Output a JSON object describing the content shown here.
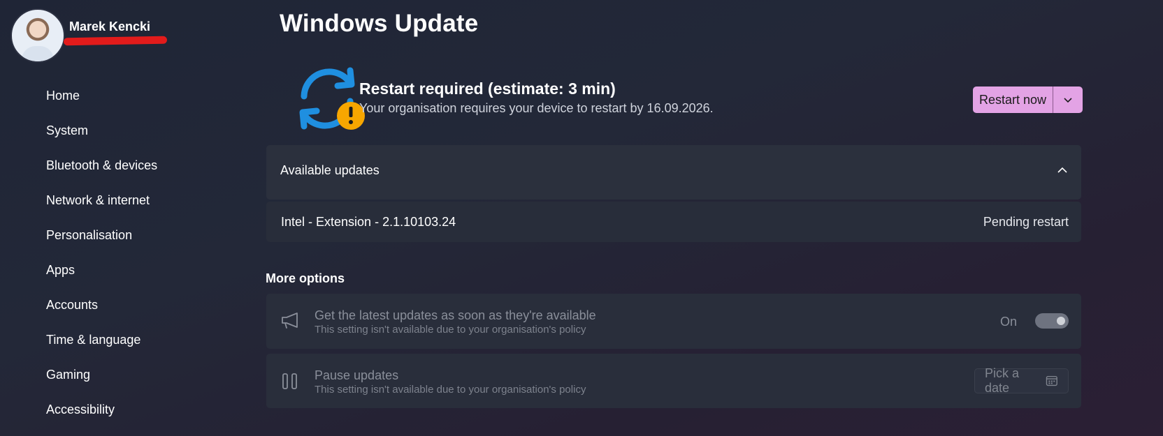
{
  "user": {
    "name": "Marek Kencki"
  },
  "nav": {
    "items": [
      "Home",
      "System",
      "Bluetooth & devices",
      "Network & internet",
      "Personalisation",
      "Apps",
      "Accounts",
      "Time & language",
      "Gaming",
      "Accessibility"
    ]
  },
  "page": {
    "title": "Windows Update"
  },
  "status": {
    "title": "Restart required (estimate: 3 min)",
    "subtitle": "Your organisation requires your device to restart by 16.09.2026.",
    "restart_button": "Restart now"
  },
  "updates": {
    "section_label": "Available updates",
    "items": [
      {
        "name": "Intel - Extension - 2.1.10103.24",
        "status": "Pending restart"
      }
    ]
  },
  "more_options": {
    "title": "More options",
    "latest_updates": {
      "title": "Get the latest updates as soon as they're available",
      "subtitle": "This setting isn't available due to your organisation's policy",
      "toggle_label": "On",
      "toggle_on": true
    },
    "pause_updates": {
      "title": "Pause updates",
      "subtitle": "This setting isn't available due to your organisation's policy",
      "button_label": "Pick a date"
    }
  },
  "colors": {
    "accent_button": "#e3a3e5",
    "sync_blue": "#1f8fe0",
    "warning_orange": "#f7a600"
  }
}
